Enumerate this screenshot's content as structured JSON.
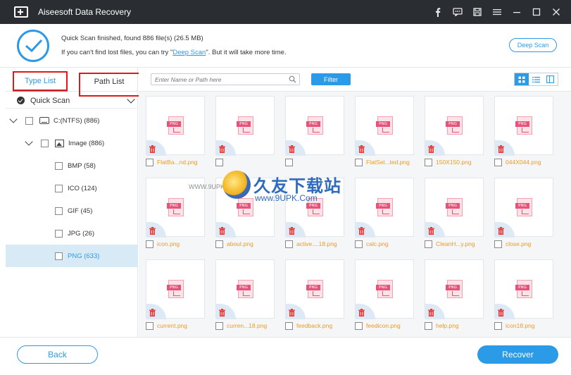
{
  "window": {
    "title": "Aiseesoft Data Recovery",
    "controls": [
      "facebook-icon",
      "feedback-icon",
      "save-icon",
      "menu-icon",
      "minimize-icon",
      "maximize-icon",
      "close-icon"
    ]
  },
  "status": {
    "line1": "Quick Scan finished, found 886 file(s) (26.5 MB)",
    "line2_prefix": "If you can't find lost files, you can try \"",
    "line2_link": "Deep Scan",
    "line2_suffix": "\". But it will take more time.",
    "deep_scan_label": "Deep Scan"
  },
  "sidebar": {
    "tabs": [
      {
        "label": "Type List",
        "active": true
      },
      {
        "label": "Path List",
        "active": false
      }
    ],
    "scan_mode": "Quick Scan",
    "tree": [
      {
        "label": "C:(NTFS) (886)",
        "icon": "drive-icon",
        "level": 0
      },
      {
        "label": "Image (886)",
        "icon": "image-icon",
        "level": 1
      },
      {
        "label": "BMP (58)",
        "level": 2
      },
      {
        "label": "ICO (124)",
        "level": 2
      },
      {
        "label": "GIF (45)",
        "level": 2
      },
      {
        "label": "JPG (26)",
        "level": 2
      },
      {
        "label": "PNG (633)",
        "level": 2,
        "selected": true
      }
    ]
  },
  "toolbar": {
    "search_placeholder": "Enter Name or Path here",
    "filter_label": "Filter"
  },
  "file_type_badge": "PNG",
  "files": [
    "FlatBa...nd.png",
    "",
    "",
    "FlatSel...ted.png",
    "150X150.png",
    "044X044.png",
    "icon.png",
    "about.png",
    "active....18.png",
    "calc.png",
    "CleanH...y.png",
    "close.png",
    "current.png",
    "curren...18.png",
    "feedback.png",
    "feedicon.png",
    "help.png",
    "icon18.png"
  ],
  "watermark": {
    "cn": "久友下载站",
    "url": "www.9UPK.Com",
    "small": "WWW.9UPK.COM"
  },
  "footer": {
    "back_label": "Back",
    "recover_label": "Recover"
  },
  "colors": {
    "accent": "#2b9be8",
    "titlebar": "#2a2e33",
    "file_name": "#f29b1d",
    "annotation": "#e01818"
  }
}
